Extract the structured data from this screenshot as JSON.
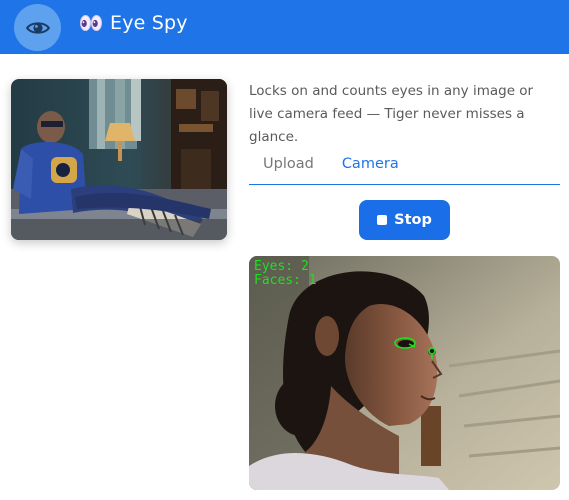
{
  "app": {
    "title": "Eye Spy",
    "logo_icon": "eye-icon",
    "title_emoji": "eyes-emoji"
  },
  "colors": {
    "header_bg": "#1f74e8",
    "accent": "#1a6fe8",
    "overlay_text": "#1fe01f"
  },
  "description": "Locks on and counts eyes in any image or live camera feed — Tiger never misses a glance.",
  "tabs": [
    {
      "label": "Upload",
      "active": false
    },
    {
      "label": "Camera",
      "active": true
    }
  ],
  "stop_button": {
    "label": "Stop",
    "icon": "stop-icon"
  },
  "camera_overlay": {
    "eyes_text": "Eyes: 2",
    "faces_text": "Faces: 1"
  }
}
